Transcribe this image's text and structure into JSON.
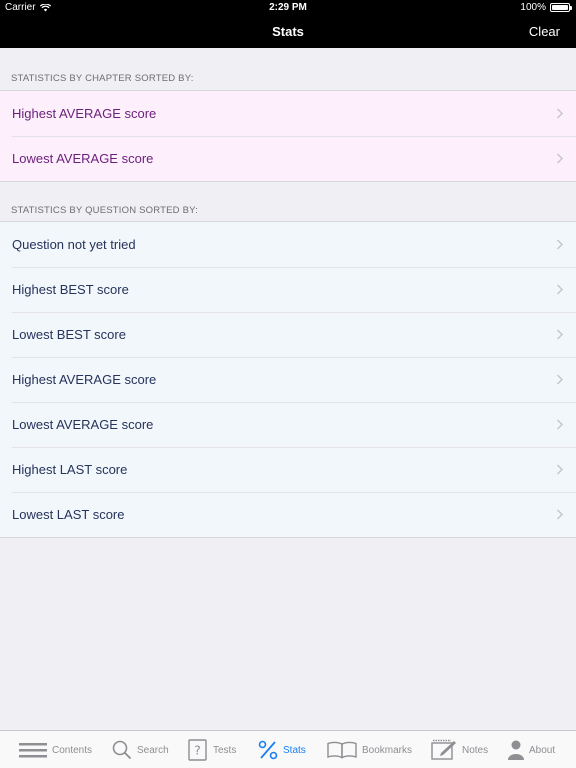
{
  "status_bar": {
    "carrier": "Carrier",
    "time": "2:29 PM",
    "battery": "100%"
  },
  "nav": {
    "title": "Stats",
    "clear_label": "Clear"
  },
  "chapter_section": {
    "header": "STATISTICS BY CHAPTER SORTED BY:",
    "items": [
      {
        "label": "Highest AVERAGE score"
      },
      {
        "label": "Lowest AVERAGE score"
      }
    ]
  },
  "question_section": {
    "header": "STATISTICS BY QUESTION SORTED BY:",
    "items": [
      {
        "label": "Question not yet tried"
      },
      {
        "label": "Highest BEST score"
      },
      {
        "label": "Lowest BEST score"
      },
      {
        "label": "Highest AVERAGE score"
      },
      {
        "label": "Lowest AVERAGE score"
      },
      {
        "label": "Highest LAST score"
      },
      {
        "label": "Lowest LAST score"
      }
    ]
  },
  "tab_bar": {
    "tabs": [
      {
        "label": "Contents",
        "icon": "list-icon",
        "active": false
      },
      {
        "label": "Search",
        "icon": "search-icon",
        "active": false
      },
      {
        "label": "Tests",
        "icon": "question-doc-icon",
        "active": false
      },
      {
        "label": "Stats",
        "icon": "percent-icon",
        "active": true
      },
      {
        "label": "Bookmarks",
        "icon": "book-icon",
        "active": false
      },
      {
        "label": "Notes",
        "icon": "notes-icon",
        "active": false
      },
      {
        "label": "About",
        "icon": "person-icon",
        "active": false
      }
    ]
  },
  "colors": {
    "chapter_row_bg": "#fdeffc",
    "chapter_text": "#6a1f7a",
    "question_row_bg": "#f2f7fc",
    "question_text": "#26335a",
    "active_tab": "#1a7ff2"
  }
}
